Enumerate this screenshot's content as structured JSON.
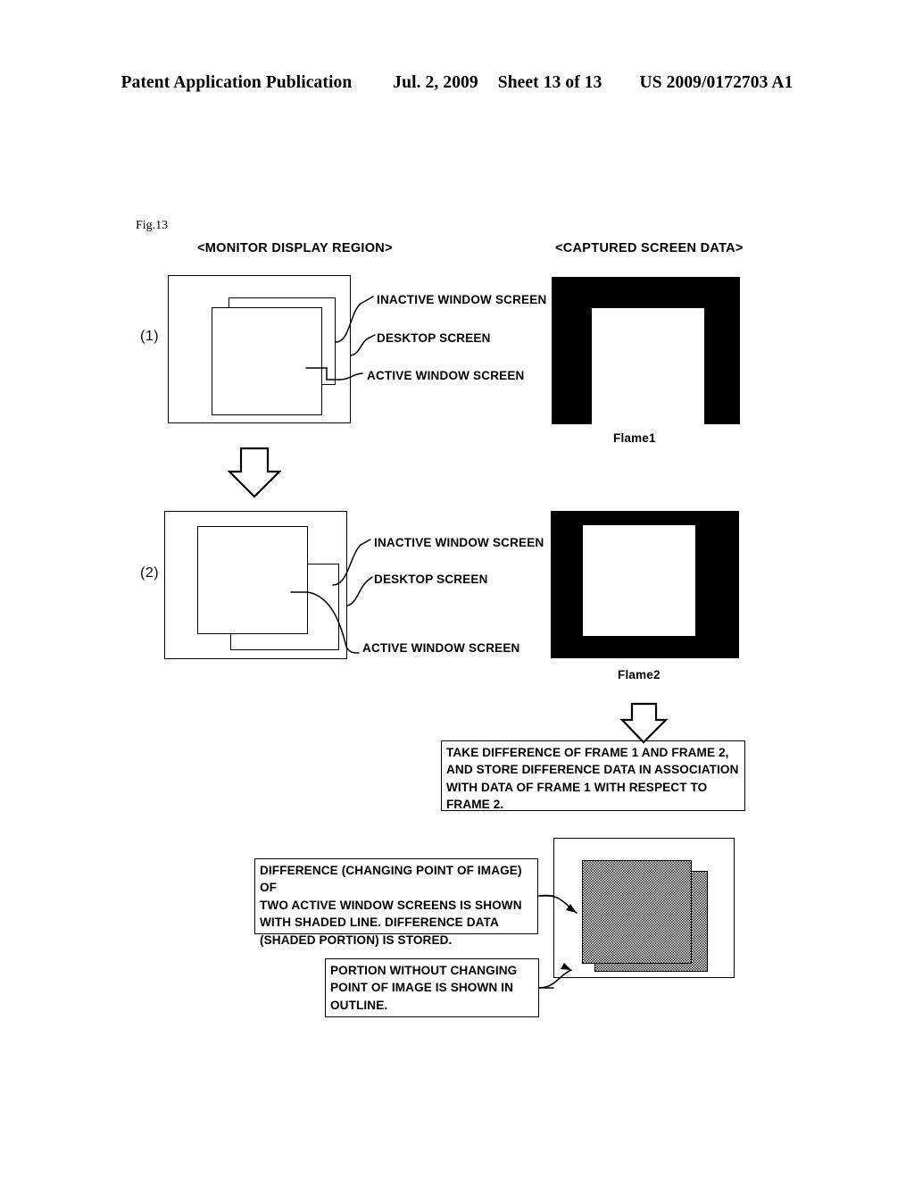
{
  "header": {
    "publication": "Patent Application Publication",
    "date": "Jul. 2, 2009",
    "sheet": "Sheet 13 of 13",
    "number": "US 2009/0172703 A1"
  },
  "figure": {
    "label": "Fig.13",
    "column_headings": {
      "left": "<MONITOR DISPLAY REGION>",
      "right": "<CAPTURED SCREEN DATA>"
    },
    "panels": [
      {
        "number": "(1)",
        "leader_labels": [
          "INACTIVE WINDOW SCREEN",
          "DESKTOP SCREEN",
          "ACTIVE WINDOW SCREEN"
        ],
        "capture_caption": "Flame1"
      },
      {
        "number": "(2)",
        "leader_labels": [
          "INACTIVE WINDOW SCREEN",
          "DESKTOP SCREEN",
          "ACTIVE WINDOW SCREEN"
        ],
        "capture_caption": "Flame2"
      }
    ],
    "notes": {
      "difference_step": "TAKE DIFFERENCE OF FRAME 1 AND FRAME 2,\nAND STORE DIFFERENCE DATA IN ASSOCIATION\nWITH DATA OF FRAME 1 WITH RESPECT TO\nFRAME 2.",
      "shaded_note": "DIFFERENCE (CHANGING POINT OF IMAGE) OF\nTWO ACTIVE WINDOW SCREENS IS SHOWN\nWITH SHADED LINE.  DIFFERENCE DATA\n(SHADED PORTION) IS STORED.",
      "outline_note": "PORTION WITHOUT CHANGING\nPOINT OF IMAGE IS SHOWN IN\nOUTLINE."
    },
    "icons": {
      "flow_arrow": "down-arrow-outline",
      "leader_arrow": "arrow-head"
    }
  }
}
